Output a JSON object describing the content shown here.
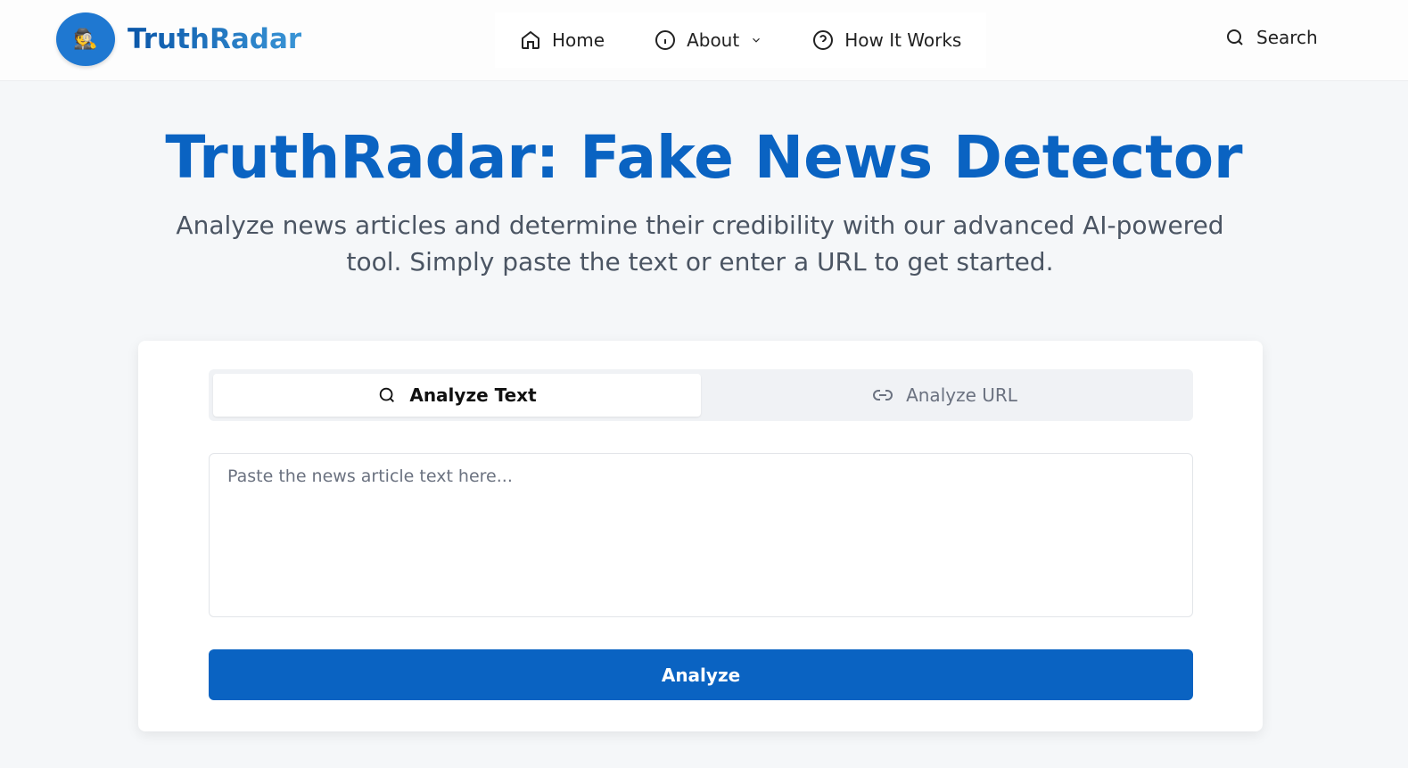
{
  "header": {
    "logo_text": "TruthRadar",
    "logo_icon": "🕵️",
    "nav": [
      {
        "label": "Home",
        "icon": "home-icon"
      },
      {
        "label": "About",
        "icon": "info-icon"
      },
      {
        "label": "How It Works",
        "icon": "help-circle-icon"
      }
    ],
    "search_label": "Search"
  },
  "hero": {
    "title": "TruthRadar: Fake News Detector",
    "subtitle": "Analyze news articles and determine their credibility with our advanced AI-powered tool. Simply paste the text or enter a URL to get started."
  },
  "card": {
    "tabs": [
      {
        "label": "Analyze Text",
        "active": true
      },
      {
        "label": "Analyze URL",
        "active": false
      }
    ],
    "textarea_placeholder": "Paste the news article text here...",
    "textarea_value": "",
    "analyze_label": "Analyze"
  },
  "colors": {
    "primary": "#0a63c2"
  }
}
